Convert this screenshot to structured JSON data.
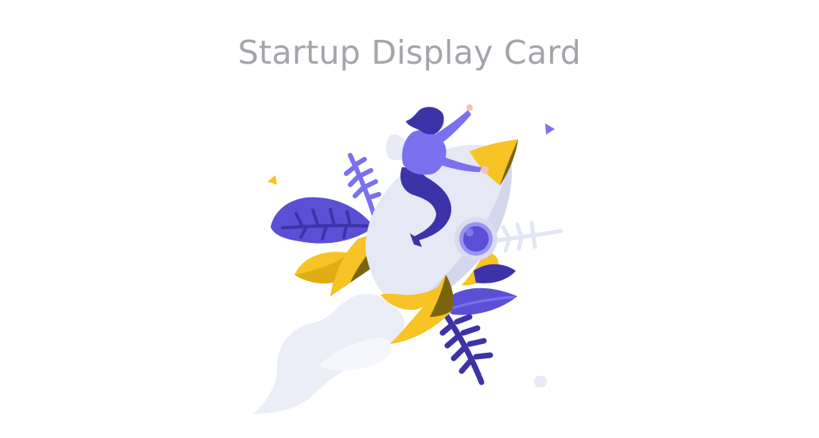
{
  "page": {
    "title": "Startup Display Card"
  },
  "illustration": {
    "subject": "woman-riding-rocket",
    "colors": {
      "purple": "#5b4fd6",
      "purple_light": "#7b70ee",
      "indigo_dark": "#3d33a8",
      "yellow": "#f7c325",
      "yellow_dark": "#7a6410",
      "rocket_body": "#e6e8f5",
      "smoke": "#eceef7",
      "leaf_pale": "#e8eaf5",
      "skin": "#f3c3b2"
    }
  }
}
